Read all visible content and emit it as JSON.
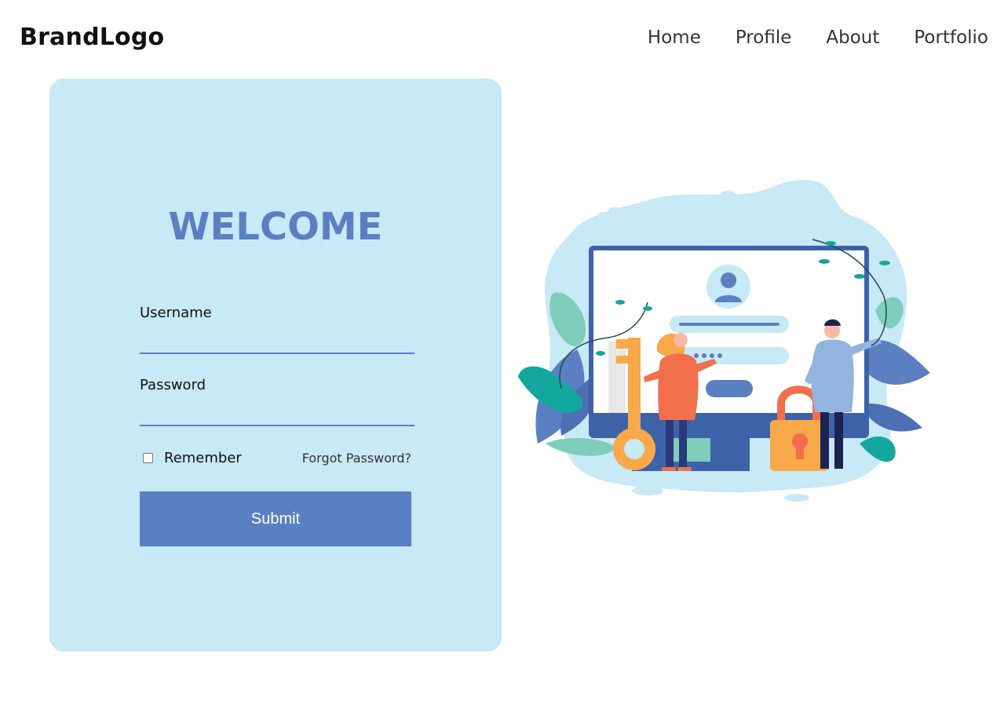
{
  "brand": {
    "label": "BrandLogo"
  },
  "nav": {
    "items": [
      {
        "label": "Home"
      },
      {
        "label": "Profile"
      },
      {
        "label": "About"
      },
      {
        "label": "Portfolio"
      }
    ]
  },
  "login": {
    "title": "WELCOME",
    "username_label": "Username",
    "username_value": "",
    "password_label": "Password",
    "password_value": "",
    "remember_label": "Remember",
    "remember_checked": false,
    "forgot_label": "Forgot Password?",
    "submit_label": "Submit"
  },
  "colors": {
    "card_background": "#c8e9f6",
    "accent": "#5a80c2",
    "illustration_orange": "#f26f4b",
    "illustration_yellow": "#f9a84a",
    "illustration_teal": "#13a89e"
  },
  "illustration": {
    "name": "login-security-illustration"
  }
}
